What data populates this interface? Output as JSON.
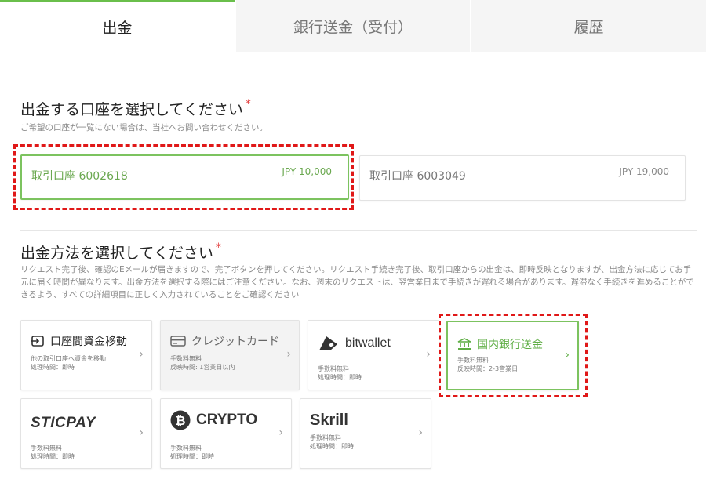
{
  "tabs": [
    {
      "label": "出金",
      "active": true
    },
    {
      "label": "銀行送金（受付）",
      "active": false
    },
    {
      "label": "履歴",
      "active": false
    }
  ],
  "account_section": {
    "title": "出金する口座を選択してください",
    "required_mark": "*",
    "note": "ご希望の口座が一覧にない場合は、当社へお問い合わせください。",
    "accounts": [
      {
        "name": "取引口座 6002618",
        "balance": "JPY 10,000",
        "selected": true
      },
      {
        "name": "取引口座 6003049",
        "balance": "JPY 19,000",
        "selected": false
      }
    ]
  },
  "method_section": {
    "title": "出金方法を選択してください",
    "required_mark": "*",
    "note": "リクエスト完了後、確認のEメールが届きますので、完了ボタンを押してください。リクエスト手続き完了後、取引口座からの出金は、即時反映となりますが、出金方法に応じてお手元に届く時間が異なります。出金方法を選択する際にはご注意ください。なお、週末のリクエストは、翌営業日まで手続きが遅れる場合があります。遅滞なく手続きを進めることができるよう、すべての詳細項目に正しく入力されていることをご確認ください",
    "methods": [
      {
        "label": "口座間資金移動",
        "icon": "transfer-icon",
        "lines": [
          "他の取引口座へ資金を移動",
          "処理時間：即時"
        ],
        "state": "normal"
      },
      {
        "label": "クレジットカード",
        "icon": "credit-card-icon",
        "lines": [
          "手数料無料",
          "反映時間: 1営業日以内"
        ],
        "state": "disabled"
      },
      {
        "label": "bitwallet",
        "icon": "bitwallet-logo",
        "lines": [
          "手数料無料",
          "処理時間：即時"
        ],
        "state": "normal"
      },
      {
        "label": "国内銀行送金",
        "icon": "bank-icon",
        "lines": [
          "手数料無料",
          "反映時間：2-3営業日"
        ],
        "state": "selected"
      },
      {
        "label": "STICPAY",
        "icon": "sticpay-logo",
        "lines": [
          "手数料無料",
          "処理時間：即時"
        ],
        "state": "normal"
      },
      {
        "label": "CRYPTO",
        "icon": "bitcoin-icon",
        "lines": [
          "手数料無料",
          "処理時間：即時"
        ],
        "state": "normal"
      },
      {
        "label": "Skrill",
        "icon": "skrill-logo",
        "lines": [
          "手数料無料",
          "処理時間：即時"
        ],
        "state": "normal"
      }
    ]
  },
  "colors": {
    "accent": "#6abf4b",
    "highlight": "#e01818",
    "required": "#e23a3a"
  }
}
